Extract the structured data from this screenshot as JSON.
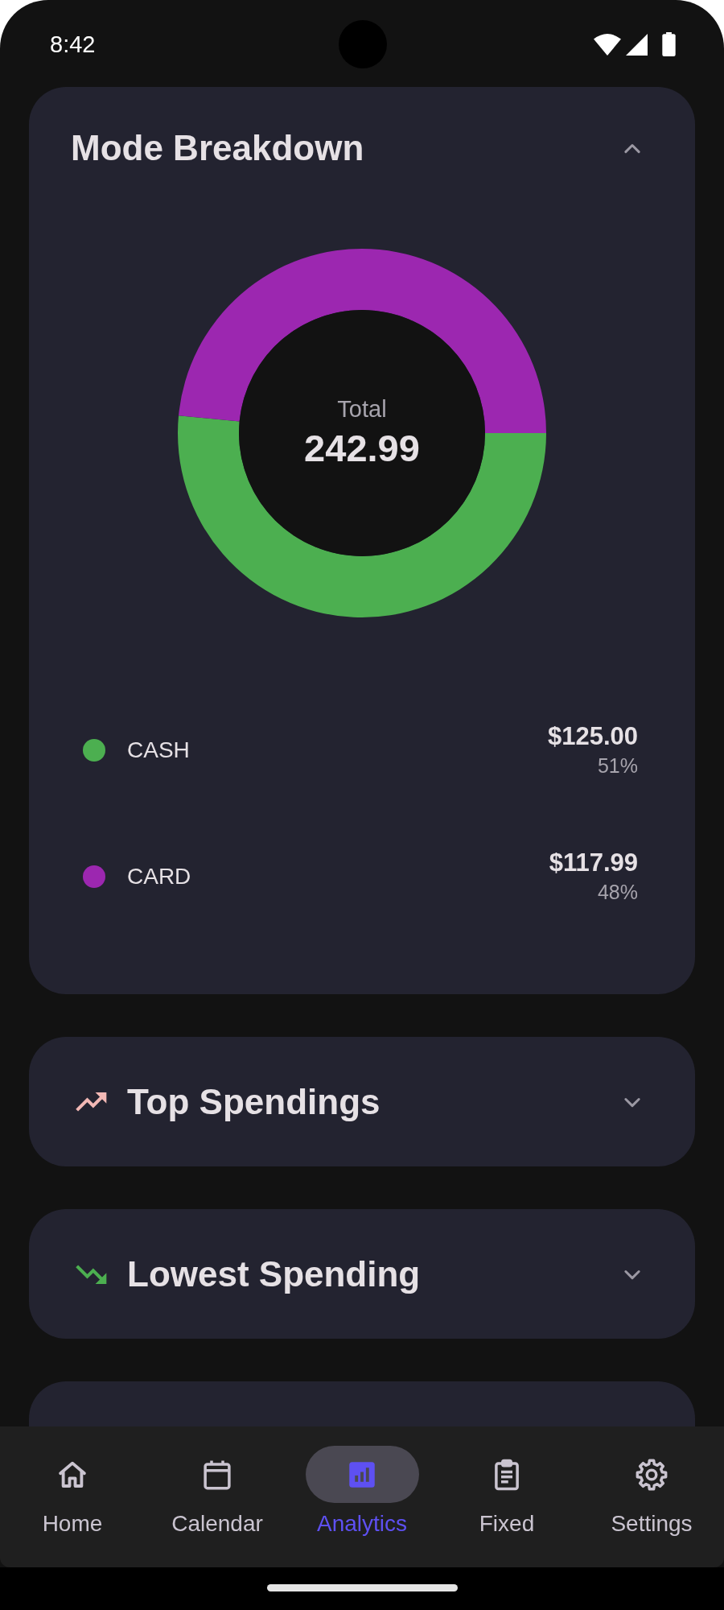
{
  "status_bar": {
    "time": "8:42"
  },
  "mode_breakdown": {
    "title": "Mode Breakdown",
    "expanded": true,
    "chart_data": {
      "type": "donut",
      "categories": [
        "CASH",
        "CARD"
      ],
      "values": [
        51,
        48
      ]
    },
    "center": {
      "label": "Total",
      "value": "242.99"
    },
    "legend": [
      {
        "amount": "$125.00",
        "percent": "51%",
        "color": "#4caf50"
      },
      {
        "amount": "$117.99",
        "percent": "48%",
        "color": "#9c27b0"
      }
    ]
  },
  "sections": [
    {
      "title": "Top Spendings",
      "kind": "rising",
      "expanded": false
    },
    {
      "title": "Lowest Spending",
      "kind": "falling",
      "expanded": false
    }
  ],
  "bottom_nav": [
    {
      "label": "Home",
      "selected": false
    },
    {
      "label": "Calendar",
      "selected": false
    },
    {
      "label": "Analytics",
      "selected": true
    },
    {
      "label": "Fixed",
      "selected": false
    },
    {
      "label": "Settings",
      "selected": false
    }
  ]
}
